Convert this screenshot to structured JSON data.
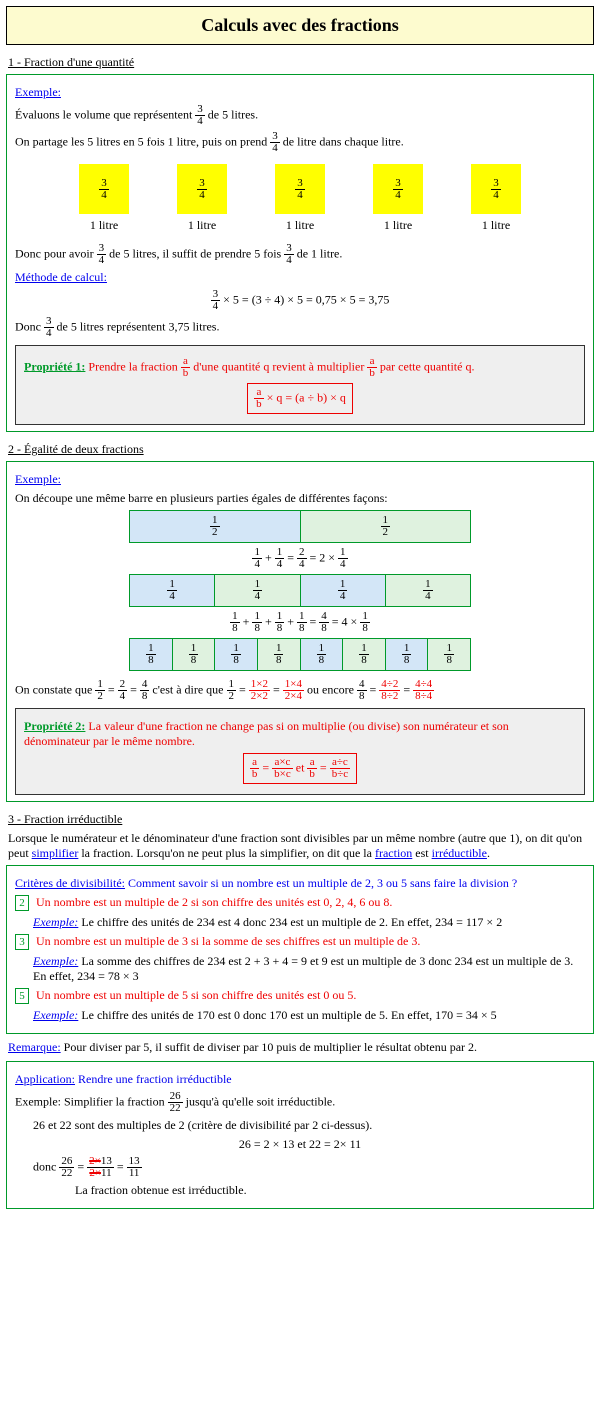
{
  "title": "Calculs avec des fractions",
  "s1": {
    "heading": "1 - Fraction d'une quantité",
    "exemple": "Exemple:",
    "l1a": "Évaluons le volume que représentent ",
    "l1b": " de 5 litres.",
    "l2a": "On partage les 5 litres en 5 fois 1 litre, puis on prend ",
    "l2b": " de litre dans chaque litre.",
    "litre": "1 litre",
    "l3a": "Donc pour avoir ",
    "l3b": " de 5 litres, il suffit de prendre 5 fois ",
    "l3c": " de 1 litre.",
    "methode": "Méthode de calcul:",
    "calc": " × 5 = (3 ÷ 4) × 5 = 0,75 × 5 = 3,75",
    "l4a": "Donc ",
    "l4b": " de 5 litres représentent 3,75 litres."
  },
  "frac34": {
    "n": "3",
    "d": "4"
  },
  "prop1": {
    "label": "Propriété 1:",
    "t1": " Prendre la fraction ",
    "t2": " d'une quantité q revient à multiplier ",
    "t3": " par cette quantité q.",
    "formula": " × q = (a ÷ b) × q"
  },
  "fracab": {
    "n": "a",
    "d": "b"
  },
  "s2": {
    "heading": "2 - Égalité de deux fractions",
    "exemple": "Exemple:",
    "l1": "On découpe une même barre en plusieurs parties égales de différentes façons:",
    "constat1": "On constate que ",
    "constat2": " c'est à dire que ",
    "constat3": " ou encore "
  },
  "bars": {
    "half": "1/2",
    "quarter": "1/4",
    "eighth": "1/8"
  },
  "eq14": {
    "text": "1/4 + 1/4 = 2/4 = 2 × 1/4"
  },
  "eq18": {
    "text": "1/8 + 1/8 + 1/8 + 1/8 = 4/8 = 4 × 1/8"
  },
  "prop2": {
    "label": "Propriété 2:",
    "t1": " La valeur d'une fraction ne change pas si on multiplie (ou divise) son numérateur et son dénominateur par le même nombre."
  },
  "s3": {
    "heading": "3 - Fraction irréductible",
    "intro1": "Lorsque le numérateur et le dénominateur d'une fraction sont divisibles par un même nombre (autre que 1), on dit qu'on peut ",
    "simplifier": "simplifier",
    "intro2": " la fraction. Lorsqu'on ne peut plus la simplifier, on dit que la ",
    "fraction": "fraction",
    "intro3": " est ",
    "irreductible": "irréductible",
    "intro4": "."
  },
  "crit": {
    "title": "Critères de divisibilité:",
    "q": " Comment savoir si un nombre est un multiple de 2, 3 ou 5 sans faire la division ?",
    "c2": " Un nombre est un multiple de 2 si son chiffre des unités est 0, 2, 4, 6 ou 8.",
    "e2": " Le chiffre des unités de 234 est 4 donc 234 est un multiple de 2. En effet, 234 = 117 × 2",
    "c3": " Un nombre est un multiple de 3 si la somme de ses chiffres est un multiple de 3.",
    "e3": " La somme des chiffres de 234 est 2 + 3 + 4 = 9 et 9 est un multiple de 3 donc 234 est un multiple de 3. En effet, 234 =  78 × 3",
    "c5": " Un nombre est un multiple de 5 si son chiffre des unités est 0 ou 5.",
    "e5": " Le chiffre des unités de 170 est 0 donc 170 est un multiple de 5. En effet, 170 = 34 × 5",
    "ex": "Exemple:"
  },
  "remarque": {
    "label": "Remarque:",
    "t": " Pour diviser par 5, il suffit de diviser par 10 puis de  multiplier le résultat obtenu par 2."
  },
  "app": {
    "title": "Application:",
    "subtitle": " Rendre une fraction irréductible",
    "l1a": "Exemple: Simplifier la fraction ",
    "l1b": " jusqu'à qu'elle soit irréductible.",
    "l2": "26 et 22 sont des multiples de 2 (critère de divisibilité par 2 ci-dessus).",
    "l3": "26 = 2 × 13   et   22 = 2× 11",
    "l4": "donc   ",
    "l5": "La fraction obtenue est irréductible."
  },
  "frac2622": {
    "n": "26",
    "d": "22"
  },
  "frac1311": {
    "n": "13",
    "d": "11"
  }
}
